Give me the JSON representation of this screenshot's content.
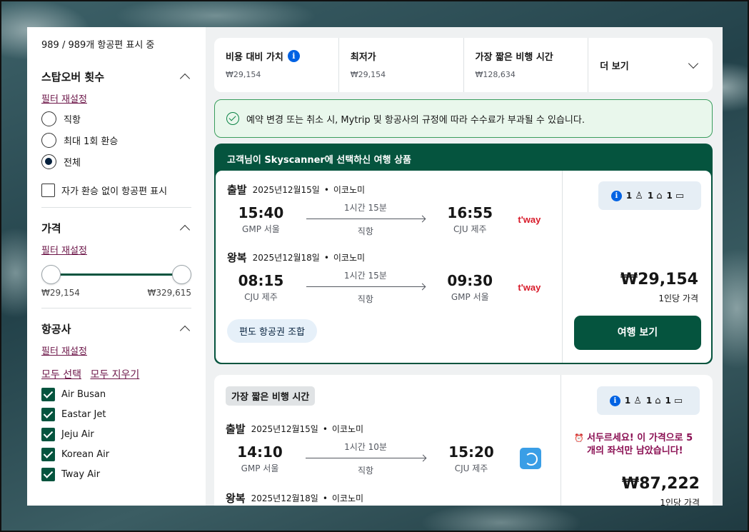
{
  "sidebar": {
    "count": "989 / 989개 항공편 표시 중",
    "stops": {
      "title": "스탑오버 횟수",
      "reset": "필터 재설정",
      "options": [
        "직항",
        "최대 1회 환승",
        "전체"
      ],
      "selected": "전체",
      "self_transfer": "자가 환승 없이 항공편 표시"
    },
    "price": {
      "title": "가격",
      "reset": "필터 재설정",
      "min": "₩29,154",
      "max": "₩329,615"
    },
    "airlines": {
      "title": "항공사",
      "reset": "필터 재설정",
      "select_all": "모두 선택",
      "clear_all": "모두 지우기",
      "items": [
        "Air Busan",
        "Eastar Jet",
        "Jeju Air",
        "Korean Air",
        "Tway Air"
      ]
    }
  },
  "sort": [
    {
      "label": "비용 대비 가치",
      "price": "₩29,154"
    },
    {
      "label": "최저가",
      "price": "₩29,154"
    },
    {
      "label": "가장 짧은 비행 시간",
      "price": "₩128,634"
    },
    {
      "label": "더 보기"
    }
  ],
  "notice": "예약 변경 또는 취소 시, Mytrip 및 항공사의 규정에 따라 수수료가 부과될 수 있습니다.",
  "featured": {
    "header": "고객님이 Skyscanner에 선택하신 여행 상품",
    "outbound": {
      "label": "출발",
      "date": "2025년12월15일",
      "cabin": "이코노미",
      "dep_time": "15:40",
      "dep_airport": "GMP 서울",
      "duration": "1시간 15분",
      "stops": "직항",
      "arr_time": "16:55",
      "arr_airport": "CJU 제주",
      "airline_logo": "t'way"
    },
    "inbound": {
      "label": "왕복",
      "date": "2025년12월18일",
      "cabin": "이코노미",
      "dep_time": "08:15",
      "dep_airport": "CJU 제주",
      "duration": "1시간 15분",
      "stops": "직항",
      "arr_time": "09:30",
      "arr_airport": "GMP 서울",
      "airline_logo": "t'way"
    },
    "chip": "편도 항공권 조합",
    "bags": {
      "personal": "1",
      "cabin": "1",
      "checked": "1"
    },
    "price": "₩29,154",
    "per": "1인당 가격",
    "button": "여행 보기"
  },
  "second": {
    "tag": "가장 짧은 비행 시간",
    "outbound": {
      "label": "출발",
      "date": "2025년12월15일",
      "cabin": "이코노미",
      "dep_time": "14:10",
      "dep_airport": "GMP 서울",
      "duration": "1시간 10분",
      "stops": "직항",
      "arr_time": "15:20",
      "arr_airport": "CJU 제주"
    },
    "inbound": {
      "label": "왕복",
      "date": "2025년12월18일",
      "cabin": "이코노미"
    },
    "bags": {
      "personal": "1",
      "cabin": "1",
      "checked": "1"
    },
    "hurry": "서두르세요! 이 가격으로 5개의 좌석만 남았습니다!",
    "price": "₩87,222",
    "per": "1인당 가격"
  },
  "colors": {
    "accent": "#05543e",
    "link": "#6c1548",
    "info": "#0062e3"
  }
}
